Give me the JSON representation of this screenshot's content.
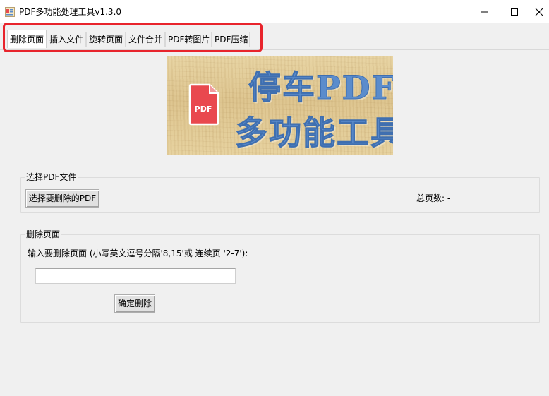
{
  "window": {
    "title": "PDF多功能处理工具v1.3.0"
  },
  "tabs": [
    {
      "label": "删除页面",
      "active": true
    },
    {
      "label": "插入文件",
      "active": false
    },
    {
      "label": "旋转页面",
      "active": false
    },
    {
      "label": "文件合并",
      "active": false
    },
    {
      "label": "PDF转图片",
      "active": false
    },
    {
      "label": "PDF压缩",
      "active": false
    }
  ],
  "banner": {
    "icon_text": "PDF",
    "line1": "停车PDF",
    "line2": "多功能工具"
  },
  "select_group": {
    "title": "选择PDF文件",
    "button_label": "选择要删除的PDF",
    "page_count_label": "总页数: -"
  },
  "delete_group": {
    "title": "删除页面",
    "instruction": "输入要删除页面 (小写英文逗号分隔'8,15'或 连续页 '2-7'):",
    "input_value": "",
    "confirm_label": "确定删除"
  },
  "colors": {
    "highlight": "#e8242c",
    "banner_text": "#5b8ccc",
    "pdf_icon": "#e9484e"
  }
}
